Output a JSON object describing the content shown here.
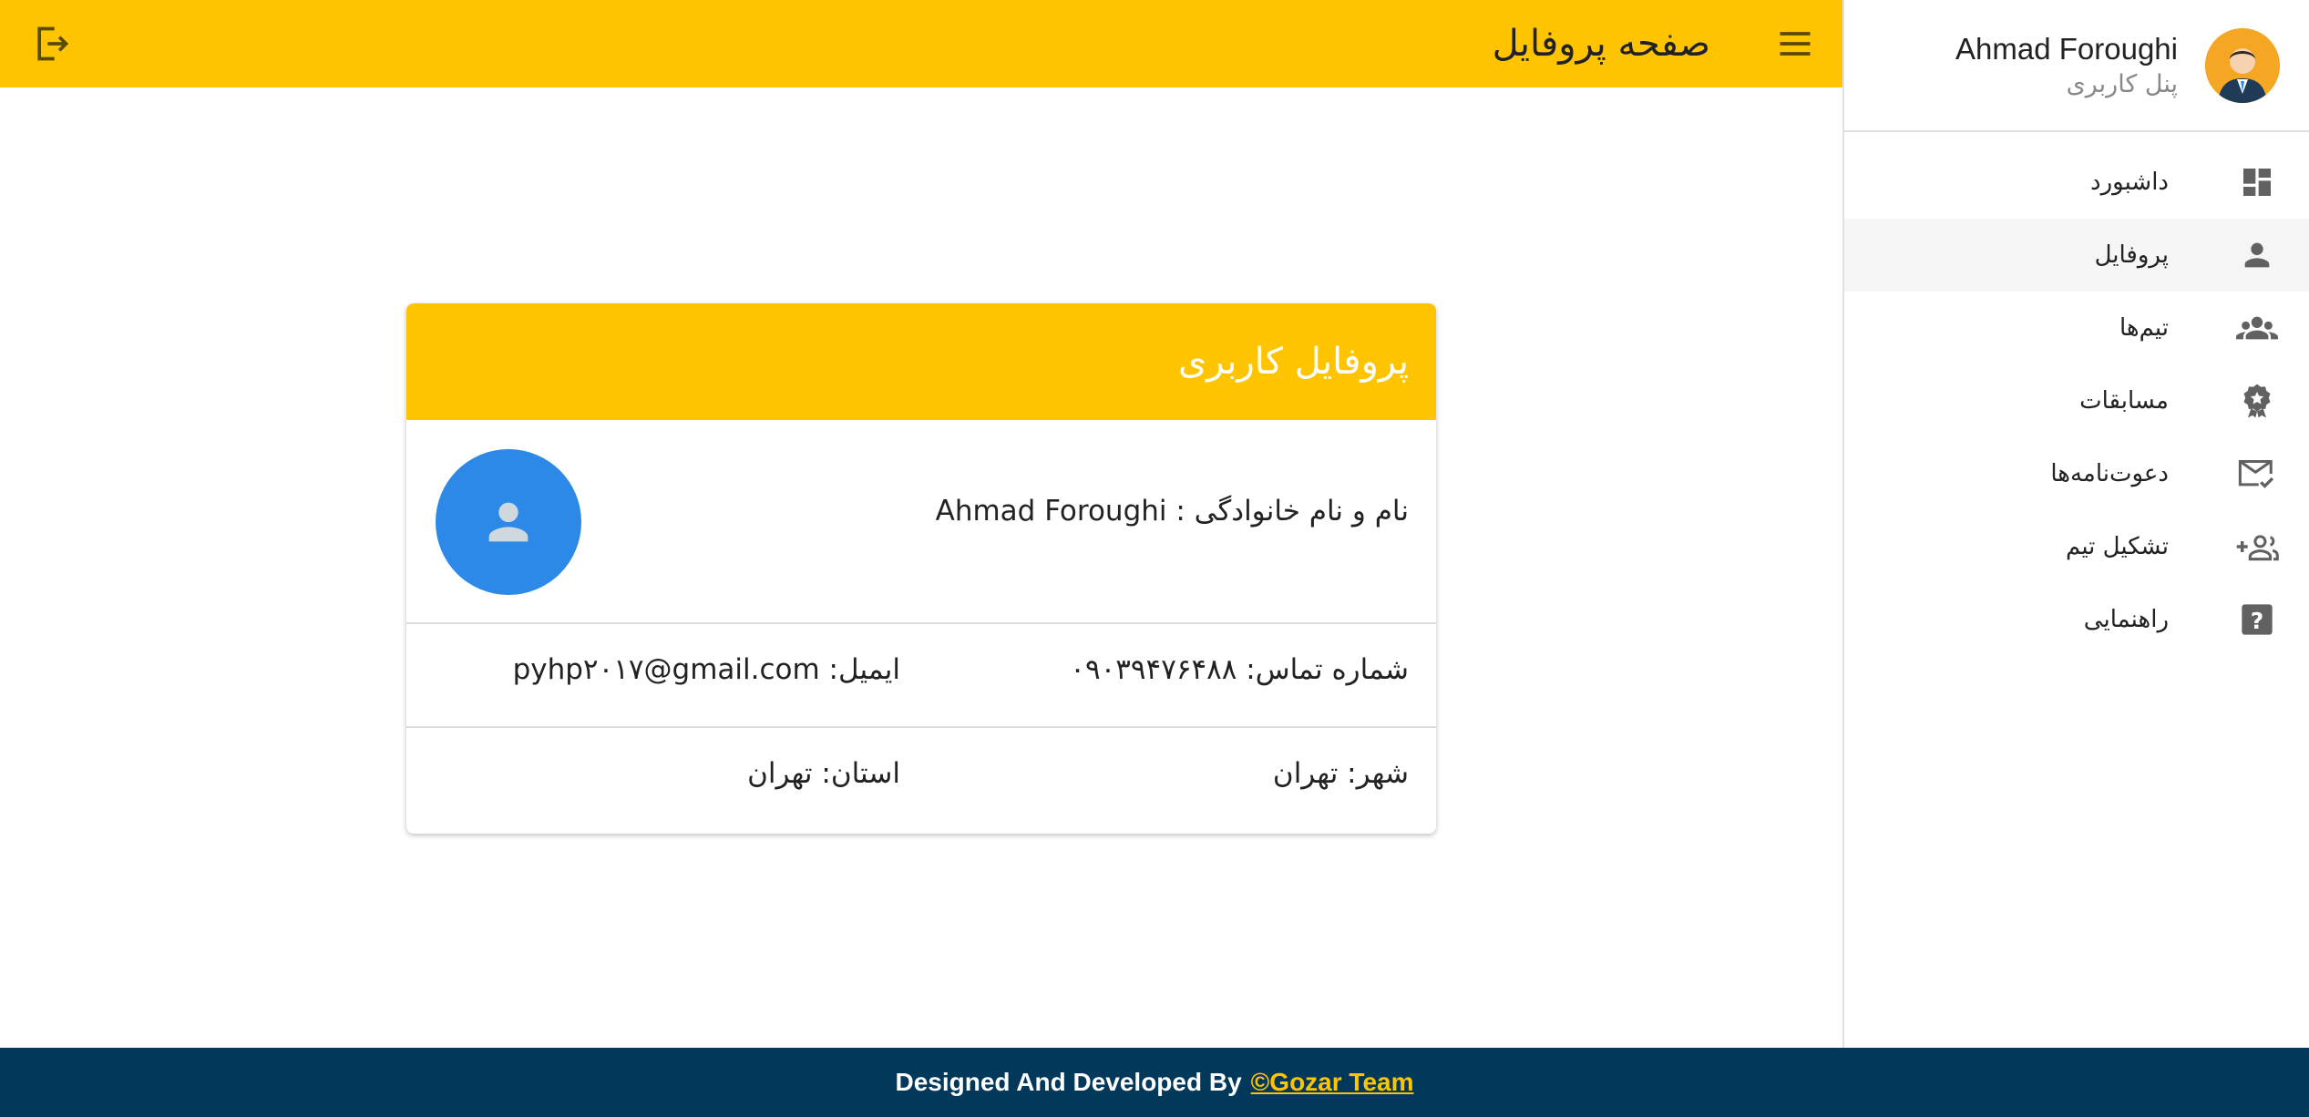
{
  "topbar": {
    "title": "صفحه پروفایل"
  },
  "sidebar": {
    "user_name": "Ahmad Foroughi",
    "user_role": "پنل کاربری",
    "items": [
      {
        "label": "داشبورد",
        "icon": "dashboard-icon"
      },
      {
        "label": "پروفایل",
        "icon": "person-icon"
      },
      {
        "label": "تیم‌ها",
        "icon": "group-icon"
      },
      {
        "label": "مسابقات",
        "icon": "award-icon"
      },
      {
        "label": "دعوت‌نامه‌ها",
        "icon": "mail-check-icon"
      },
      {
        "label": "تشکیل تیم",
        "icon": "group-add-icon"
      },
      {
        "label": "راهنمایی",
        "icon": "help-icon"
      }
    ]
  },
  "card": {
    "title": "پروفایل کاربری",
    "name_field": "نام و نام خانوادگی : Ahmad Foroughi",
    "phone_field": "شماره تماس: ۰۹۰۳۹۴۷۶۴۸۸",
    "email_field": "ایمیل: pyhp۲۰۱۷@gmail.com",
    "city_field": "شهر: تهران",
    "province_field": "استان: تهران"
  },
  "footer": {
    "text": "Designed And Developed By",
    "link": "©Gozar Team"
  },
  "colors": {
    "accent": "#ffc400",
    "footer_bg": "#02385a",
    "avatar_blue": "#2d89e8",
    "icon_gray": "#616161"
  }
}
